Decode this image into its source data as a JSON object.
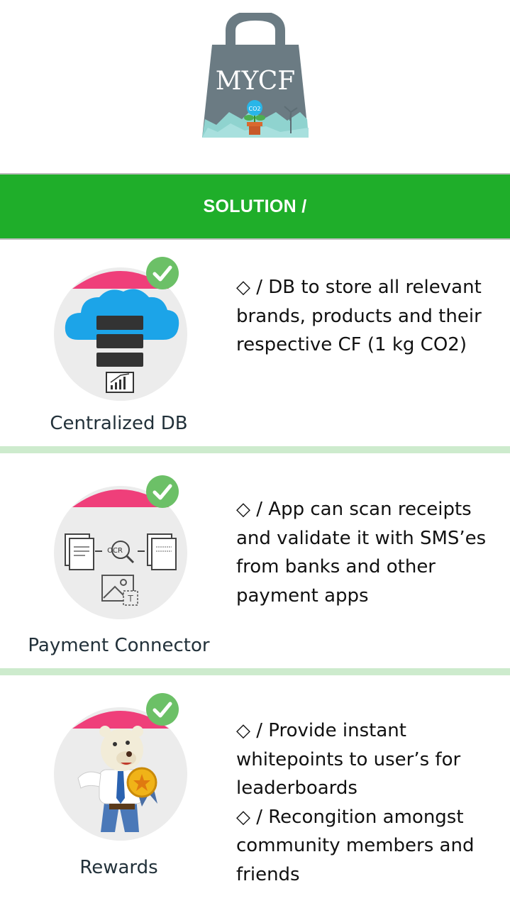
{
  "logo": {
    "text": "MYCF",
    "badge": "CO2"
  },
  "banner": {
    "title": "SOLUTION /"
  },
  "colors": {
    "green": "#1fae2a",
    "pink": "#ef3f7a",
    "check": "#6cc067",
    "divider": "#cdebcd",
    "cloud": "#1ca4e8"
  },
  "sections": [
    {
      "caption": "Centralized DB",
      "icon": "cloud-database-icon",
      "lines": [
        "◇ / DB to store all relevant brands, products and their respective CF (1 kg CO2)"
      ]
    },
    {
      "caption": "Payment Connector",
      "icon": "ocr-scan-icon",
      "ocr_label": "OCR",
      "lines": [
        "◇ / App can scan receipts and validate it with SMS’es from banks and other payment apps"
      ]
    },
    {
      "caption": "Rewards",
      "icon": "bear-mascot-icon",
      "lines": [
        "◇ / Provide instant whitepoints to user’s for leaderboards",
        "◇ / Recongition amongst community members and friends"
      ]
    }
  ]
}
